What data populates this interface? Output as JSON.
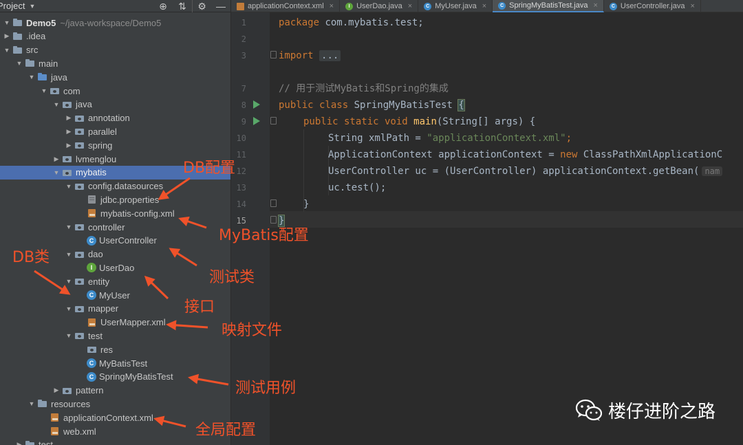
{
  "project_panel": {
    "title": "Project",
    "toolbar": [
      "target-icon",
      "collapse-icon",
      "gear-icon",
      "minimize-icon"
    ],
    "rows": [
      {
        "name": "Demo5",
        "path": "~/java-workspace/Demo5",
        "icon": "module-folder",
        "arrow": "down",
        "indent": 0
      },
      {
        "name": ".idea",
        "icon": "folder",
        "arrow": "right",
        "indent": 0
      },
      {
        "name": "src",
        "icon": "folder",
        "arrow": "down",
        "indent": 0
      },
      {
        "name": "main",
        "icon": "folder",
        "arrow": "down",
        "indent": 1
      },
      {
        "name": "java",
        "icon": "source-folder",
        "arrow": "down",
        "indent": 2
      },
      {
        "name": "com",
        "icon": "package",
        "arrow": "down",
        "indent": 3
      },
      {
        "name": "java",
        "icon": "package",
        "arrow": "down",
        "indent": 4
      },
      {
        "name": "annotation",
        "icon": "package",
        "arrow": "right",
        "indent": 5
      },
      {
        "name": "parallel",
        "icon": "package",
        "arrow": "right",
        "indent": 5
      },
      {
        "name": "spring",
        "icon": "package",
        "arrow": "right",
        "indent": 5
      },
      {
        "name": "lvmenglou",
        "icon": "package",
        "arrow": "right",
        "indent": 4
      },
      {
        "name": "mybatis",
        "icon": "package",
        "arrow": "down",
        "indent": 4,
        "selected": true
      },
      {
        "name": "config.datasources",
        "icon": "package",
        "arrow": "down",
        "indent": 5
      },
      {
        "name": "jdbc.properties",
        "icon": "properties-file",
        "arrow": "",
        "indent": 6
      },
      {
        "name": "mybatis-config.xml",
        "icon": "xml-file",
        "arrow": "",
        "indent": 6
      },
      {
        "name": "controller",
        "icon": "package",
        "arrow": "down",
        "indent": 5
      },
      {
        "name": "UserController",
        "icon": "class",
        "arrow": "",
        "indent": 6
      },
      {
        "name": "dao",
        "icon": "package",
        "arrow": "down",
        "indent": 5
      },
      {
        "name": "UserDao",
        "icon": "interface",
        "arrow": "",
        "indent": 6
      },
      {
        "name": "entity",
        "icon": "package",
        "arrow": "down",
        "indent": 5
      },
      {
        "name": "MyUser",
        "icon": "class",
        "arrow": "",
        "indent": 6
      },
      {
        "name": "mapper",
        "icon": "package",
        "arrow": "down",
        "indent": 5
      },
      {
        "name": "UserMapper.xml",
        "icon": "xml-file",
        "arrow": "",
        "indent": 6
      },
      {
        "name": "test",
        "icon": "package",
        "arrow": "down",
        "indent": 5
      },
      {
        "name": "res",
        "icon": "package",
        "arrow": "",
        "indent": 6
      },
      {
        "name": "MyBatisTest",
        "icon": "class",
        "arrow": "",
        "indent": 6
      },
      {
        "name": "SpringMyBatisTest",
        "icon": "class",
        "arrow": "",
        "indent": 6
      },
      {
        "name": "pattern",
        "icon": "package",
        "arrow": "right",
        "indent": 4
      },
      {
        "name": "resources",
        "icon": "folder",
        "arrow": "down",
        "indent": 2
      },
      {
        "name": "applicationContext.xml",
        "icon": "xml-file",
        "arrow": "",
        "indent": 3
      },
      {
        "name": "web.xml",
        "icon": "xml-file",
        "arrow": "",
        "indent": 3
      },
      {
        "name": "test",
        "icon": "folder",
        "arrow": "right",
        "indent": 1
      }
    ]
  },
  "tabs": [
    {
      "label": "applicationContext.xml",
      "icon": "xml-file"
    },
    {
      "label": "UserDao.java",
      "icon": "interface"
    },
    {
      "label": "MyUser.java",
      "icon": "class"
    },
    {
      "label": "SpringMyBatisTest.java",
      "icon": "class",
      "active": true
    },
    {
      "label": "UserController.java",
      "icon": "class"
    }
  ],
  "editor": {
    "line_numbers": [
      "1",
      "2",
      "3",
      "7",
      "8",
      "9",
      "10",
      "11",
      "12",
      "13",
      "14",
      "15"
    ],
    "current_line": "15",
    "lines": {
      "l1_kw": "package",
      "l1_rest": " com.mybatis.test;",
      "l3_kw": "import",
      "l3_fold": "...",
      "l7_comment": "// 用于测试MyBatis和Spring的集成",
      "l8_kw": "public class",
      "l8_name": " SpringMyBatisTest ",
      "l8_brace": "{",
      "l9_kw": "public static void",
      "l9_fn": "main",
      "l9_rest": "(String[] args) {",
      "l10_type": "String xmlPath = ",
      "l10_str": "\"applicationContext.xml\"",
      "l10_end": ";",
      "l11_a": "ApplicationContext applicationContext = ",
      "l11_kw": "new",
      "l11_b": " ClassPathXmlApplicationC",
      "l12_a": "UserController uc = (UserController) applicationContext.getBean(",
      "l12_hint": "nam",
      "l13": "uc.test();",
      "l14": "}",
      "l15": "}"
    }
  },
  "annotations": {
    "db_config": "DB配置",
    "mybatis_config": "MyBatis配置",
    "db_class": "DB类",
    "test_class": "测试类",
    "interface": "接口",
    "mapping_file": "映射文件",
    "test_case": "测试用例",
    "global_config": "全局配置",
    "color": "#f0522a"
  },
  "watermark": {
    "text": "楼仔进阶之路",
    "icon": "wechat-icon"
  }
}
